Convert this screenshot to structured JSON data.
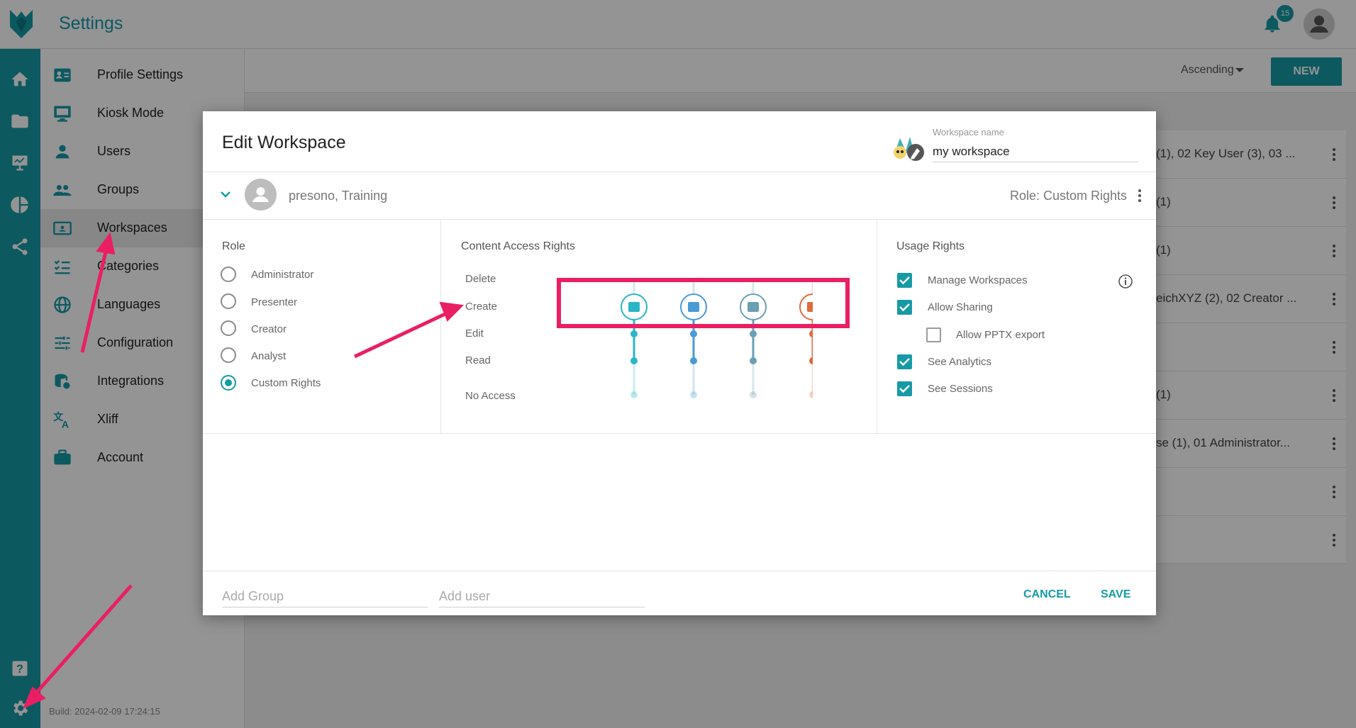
{
  "app": {
    "title": "Settings",
    "notification_count": "15",
    "build": "Build: 2024-02-09 17:24:15"
  },
  "colors": {
    "accent": "#169aa6",
    "annotation": "#ea1f63"
  },
  "rail": {
    "items": [
      {
        "icon": "home-icon"
      },
      {
        "icon": "folder-icon"
      },
      {
        "icon": "presentation-icon"
      },
      {
        "icon": "pie-chart-icon"
      },
      {
        "icon": "share-icon"
      },
      {
        "icon": "help-icon"
      },
      {
        "icon": "gear-icon"
      }
    ]
  },
  "menu": {
    "items": [
      {
        "label": "Profile Settings",
        "icon": "profile-card-icon"
      },
      {
        "label": "Kiosk Mode",
        "icon": "monitor-icon"
      },
      {
        "label": "Users",
        "icon": "user-icon"
      },
      {
        "label": "Groups",
        "icon": "group-icon"
      },
      {
        "label": "Workspaces",
        "icon": "workspace-icon"
      },
      {
        "label": "Categories",
        "icon": "checklist-icon"
      },
      {
        "label": "Languages",
        "icon": "globe-icon"
      },
      {
        "label": "Configuration",
        "icon": "sliders-icon"
      },
      {
        "label": "Integrations",
        "icon": "database-icon"
      },
      {
        "label": "Xliff",
        "icon": "translate-icon"
      },
      {
        "label": "Account",
        "icon": "briefcase-icon"
      }
    ],
    "active": "Workspaces"
  },
  "toolbar": {
    "sort_label": "Ascending",
    "new_label": "NEW"
  },
  "table_rows": [
    "(1), 02 Key User (3), 03 ...",
    "(1)",
    "(1)",
    "eichXYZ (2), 02 Creator ...",
    "",
    "(1)",
    "se (1), 01 Administrator...",
    "",
    ""
  ],
  "modal": {
    "title": "Edit Workspace",
    "workspace_name_label": "Workspace name",
    "workspace_name_value": "my workspace",
    "user": {
      "name": "presono, Training",
      "role": "Role: Custom Rights"
    },
    "role": {
      "title": "Role",
      "options": [
        "Administrator",
        "Presenter",
        "Creator",
        "Analyst",
        "Custom Rights"
      ],
      "selected": "Custom Rights"
    },
    "content_access": {
      "title": "Content Access Rights",
      "levels": [
        "Delete",
        "Create",
        "Edit",
        "Read",
        "No Access"
      ],
      "tracks": [
        {
          "icon": "slide-icon",
          "color": "#2bb5c6",
          "level": "Create"
        },
        {
          "icon": "presentation-icon",
          "color": "#4a9ad6",
          "level": "Create"
        },
        {
          "icon": "image-edit-icon",
          "color": "#6a9fb4",
          "level": "Create"
        },
        {
          "icon": "image-file-icon",
          "color": "#e06a3e",
          "level": "Create"
        }
      ]
    },
    "usage": {
      "title": "Usage Rights",
      "items": [
        {
          "label": "Manage Workspaces",
          "checked": true
        },
        {
          "label": "Allow Sharing",
          "checked": true
        },
        {
          "label": "Allow PPTX export",
          "checked": false
        },
        {
          "label": "See Analytics",
          "checked": true
        },
        {
          "label": "See Sessions",
          "checked": true
        }
      ]
    },
    "footer": {
      "add_group_placeholder": "Add Group",
      "add_user_placeholder": "Add user",
      "cancel_label": "CANCEL",
      "save_label": "SAVE"
    }
  }
}
